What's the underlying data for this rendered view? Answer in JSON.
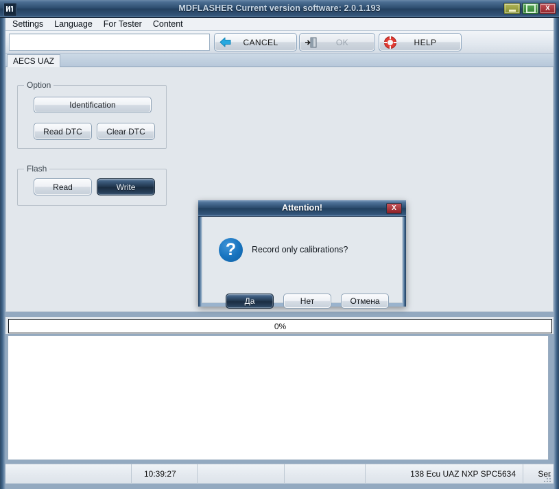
{
  "window": {
    "title": "MDFLASHER  Current version software: 2.0.1.193",
    "app_icon": "app-icon",
    "controls": {
      "minimize_label": "",
      "maximize_label": "",
      "close_label": "X"
    }
  },
  "menu": {
    "items": [
      {
        "label": "Settings"
      },
      {
        "label": "Language"
      },
      {
        "label": "For Tester"
      },
      {
        "label": "Content"
      }
    ]
  },
  "toolbar": {
    "path_value": "",
    "path_placeholder": "",
    "buttons": [
      {
        "label": "CANCEL",
        "icon": "back-arrow-icon",
        "disabled": false
      },
      {
        "label": "OK",
        "icon": "exit-door-icon",
        "disabled": true
      },
      {
        "label": "HELP",
        "icon": "lifebuoy-icon",
        "disabled": false
      }
    ]
  },
  "tabs": [
    {
      "label": "AECS UAZ",
      "active": true
    }
  ],
  "main": {
    "groups": [
      {
        "title": "Option",
        "buttons": [
          {
            "label": "Identification",
            "focused": false
          },
          {
            "label": "Read DTC",
            "focused": false
          },
          {
            "label": "Clear DTC",
            "focused": false
          }
        ]
      },
      {
        "title": "Flash",
        "buttons": [
          {
            "label": "Read",
            "focused": false
          },
          {
            "label": "Write",
            "focused": true
          }
        ]
      }
    ]
  },
  "progress": {
    "label": "0%",
    "percent": 0
  },
  "log": {
    "text": ""
  },
  "status_bar": {
    "cells": [
      {
        "text": ""
      },
      {
        "text": "10:39:27"
      },
      {
        "text": ""
      },
      {
        "text": ""
      },
      {
        "text": "138 Ecu UAZ NXP SPC5634"
      },
      {
        "text": "Ser"
      }
    ]
  },
  "dialog": {
    "title": "Attention!",
    "close_label": "X",
    "icon": "question-icon",
    "icon_glyph": "?",
    "message": "Record only calibrations?",
    "buttons": [
      {
        "label": "Да",
        "focused": true
      },
      {
        "label": "Нет",
        "focused": false
      },
      {
        "label": "Отмена",
        "focused": false
      }
    ]
  },
  "colors": {
    "title_bar": "#23405f",
    "frame": "#93a9c0",
    "panel": "#e2e7ec",
    "accent_focus": "#20354c",
    "close_red": "#8e2026",
    "minimize_yellow": "#7f8b2c",
    "maximize_green": "#2d7a2d",
    "question_blue": "#1874bf"
  }
}
